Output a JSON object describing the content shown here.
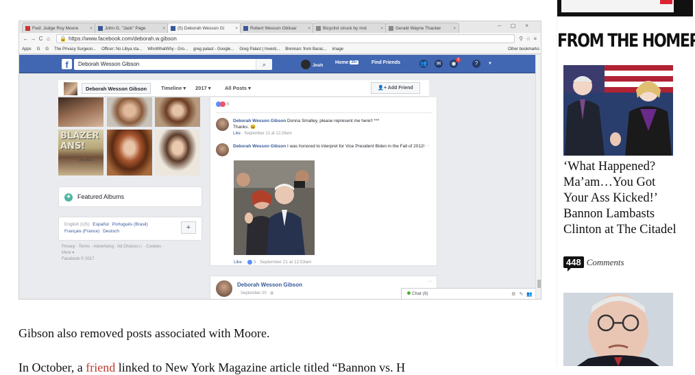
{
  "browser": {
    "tabs": [
      {
        "label": "Fwd: Judge Roy Moore",
        "icon": "gmail-icon",
        "active": false
      },
      {
        "label": "John G. \"Jack\" Page",
        "icon": "facebook-icon",
        "active": false
      },
      {
        "label": "(5) Deborah Wesson Gi",
        "icon": "facebook-icon",
        "active": true
      },
      {
        "label": "Robert Wesson Obituar",
        "icon": "page-icon",
        "active": false
      },
      {
        "label": "Bicyclist struck by mot",
        "icon": "page-icon",
        "active": false
      },
      {
        "label": "Gerald Wayne Thacker",
        "icon": "page-icon",
        "active": false
      }
    ],
    "url": "https://www.facebook.com/deborah.w.gibson",
    "bookmarks": [
      "Apps",
      "G",
      "G",
      "The Privacy Surgeon...",
      "Officer: No Libya sta...",
      "WhoWhatWhy - Gro...",
      "greg palast - Google...",
      "Greg Palast | Investi...",
      "Brennan: from Barac...",
      "image"
    ],
    "other_bookmarks": "Other bookmarks"
  },
  "facebook": {
    "logo": "f",
    "search_value": "Deborah Wesson Gibson",
    "user_name": "Josh",
    "home_label": "Home",
    "home_count": "20+",
    "find_friends": "Find Friends",
    "notif_badge": "3",
    "profile": {
      "name": "Deborah Wesson Gibson",
      "timeline": "Timeline",
      "year": "2017",
      "filter": "All Posts",
      "add_friend": "Add Friend"
    },
    "photo_overlay_text": "BLAZER\nANS!",
    "photo_overlay_sub": "etta Poss",
    "featured_albums": "Featured Albums",
    "languages": {
      "current": "English (US)",
      "others": [
        "Español",
        "Português (Brasil)",
        "Français (France)",
        "Deutsch"
      ]
    },
    "footer": [
      "Privacy",
      "Terms",
      "Advertising",
      "Ad Choices",
      "Cookies",
      "More",
      "Facebook © 2017"
    ],
    "reaction_count": "6",
    "comments": [
      {
        "author": "Deborah Wesson Gibson",
        "text": "Donna Smalley, please represent me here!! ***",
        "text2": "Thanks.",
        "like": "Like",
        "time": "September 21 at 12:28am"
      },
      {
        "author": "Deborah Wesson Gibson",
        "text": "I was honored to interpret for Vice President Biden in the Fall of 2012!",
        "like": "Like",
        "reactions": "3",
        "time": "September 21 at 12:53am"
      }
    ],
    "next_post": {
      "author": "Deborah Wesson Gibson",
      "date": "September 20"
    },
    "chat": "Chat (9)"
  },
  "article": {
    "caption": "Gibson also removed posts associated with Moore.",
    "next_line_start": "In October, a",
    "next_line_link": "friend",
    "next_line_rest": "linked to New York Magazine article titled “Bannon vs. H"
  },
  "sidebar": {
    "heading": "FROM THE HOMEPAGE",
    "story1": {
      "headline": "‘What Happened? Ma’am…You Got Your Ass Kicked!’ Bannon Lambasts Clinton at The Citadel",
      "comment_count": "448",
      "comments_label": "Comments"
    }
  },
  "colors": {
    "facebook_blue": "#4267b2",
    "link_blue": "#365899",
    "article_link": "#c0392b"
  }
}
